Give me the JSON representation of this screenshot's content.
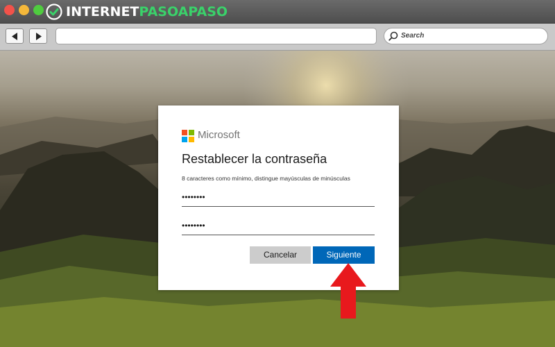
{
  "browser": {
    "brand_part1": "INTERNET",
    "brand_part2": "PASOAPASO",
    "brand_color": "#3ad26a",
    "back_icon": "back-arrow-icon",
    "forward_icon": "forward-arrow-icon",
    "address_value": "",
    "search_label": "Search"
  },
  "dialog": {
    "company": "Microsoft",
    "title": "Restablecer la contraseña",
    "hint": "8 caracteres como mínimo, distingue mayúsculas de minúsculas",
    "password1": "••••••••",
    "password2": "••••••••",
    "cancel_label": "Cancelar",
    "next_label": "Siguiente",
    "accent_color": "#0067b8"
  },
  "annotation": {
    "arrow_icon": "red-up-arrow-icon",
    "arrow_color": "#e8191d"
  }
}
